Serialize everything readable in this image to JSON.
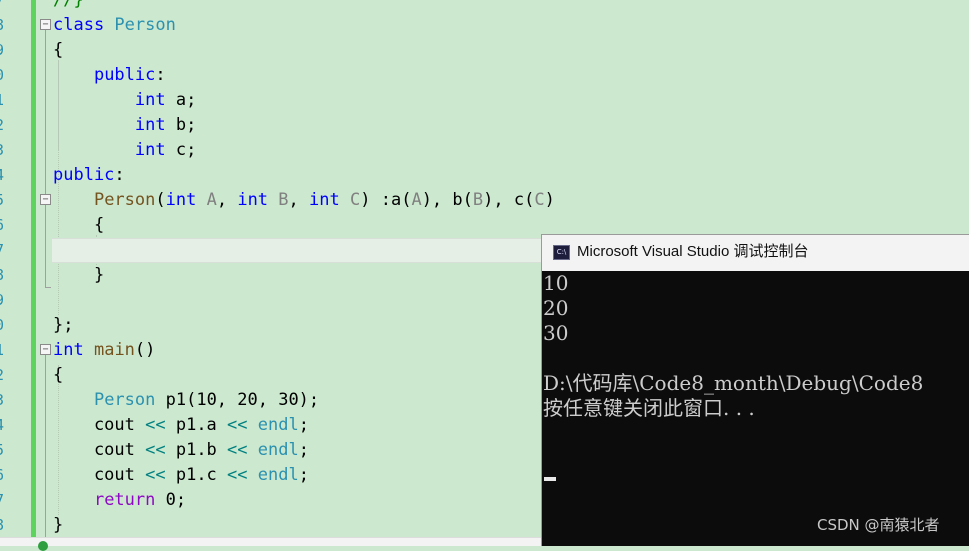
{
  "editor": {
    "line_numbers": [
      "7",
      "8",
      "9",
      "0",
      "1",
      "2",
      "3",
      "4",
      "5",
      "6",
      "7",
      "8",
      "9",
      "0",
      "1",
      "2",
      "3",
      "4",
      "5",
      "6",
      "7",
      "8"
    ],
    "lines": [
      [
        {
          "c": "cm",
          "t": "//}"
        }
      ],
      [
        {
          "c": "kw",
          "t": "class "
        },
        {
          "c": "cls",
          "t": "Person"
        }
      ],
      [
        {
          "c": "",
          "t": "{"
        }
      ],
      [
        {
          "c": "",
          "t": "    "
        },
        {
          "c": "kw",
          "t": "public"
        },
        {
          "c": "",
          "t": ":"
        }
      ],
      [
        {
          "c": "",
          "t": "        "
        },
        {
          "c": "kw",
          "t": "int"
        },
        {
          "c": "",
          "t": " a;"
        }
      ],
      [
        {
          "c": "",
          "t": "        "
        },
        {
          "c": "kw",
          "t": "int"
        },
        {
          "c": "",
          "t": " b;"
        }
      ],
      [
        {
          "c": "",
          "t": "        "
        },
        {
          "c": "kw",
          "t": "int"
        },
        {
          "c": "",
          "t": " c;"
        }
      ],
      [
        {
          "c": "kw",
          "t": "public"
        },
        {
          "c": "",
          "t": ":"
        }
      ],
      [
        {
          "c": "",
          "t": "    "
        },
        {
          "c": "fn",
          "t": "Person"
        },
        {
          "c": "",
          "t": "("
        },
        {
          "c": "kw",
          "t": "int"
        },
        {
          "c": "",
          "t": " "
        },
        {
          "c": "param",
          "t": "A"
        },
        {
          "c": "",
          "t": ", "
        },
        {
          "c": "kw",
          "t": "int"
        },
        {
          "c": "",
          "t": " "
        },
        {
          "c": "param",
          "t": "B"
        },
        {
          "c": "",
          "t": ", "
        },
        {
          "c": "kw",
          "t": "int"
        },
        {
          "c": "",
          "t": " "
        },
        {
          "c": "param",
          "t": "C"
        },
        {
          "c": "",
          "t": ") :a("
        },
        {
          "c": "param",
          "t": "A"
        },
        {
          "c": "",
          "t": "), b("
        },
        {
          "c": "param",
          "t": "B"
        },
        {
          "c": "",
          "t": "), c("
        },
        {
          "c": "param",
          "t": "C"
        },
        {
          "c": "",
          "t": ")"
        }
      ],
      [
        {
          "c": "",
          "t": "    {"
        }
      ],
      [
        {
          "c": "",
          "t": ""
        }
      ],
      [
        {
          "c": "",
          "t": "    }"
        }
      ],
      [
        {
          "c": "",
          "t": ""
        }
      ],
      [
        {
          "c": "",
          "t": "};"
        }
      ],
      [
        {
          "c": "kw",
          "t": "int"
        },
        {
          "c": "",
          "t": " "
        },
        {
          "c": "fn",
          "t": "main"
        },
        {
          "c": "",
          "t": "()"
        }
      ],
      [
        {
          "c": "",
          "t": "{"
        }
      ],
      [
        {
          "c": "",
          "t": "    "
        },
        {
          "c": "cls",
          "t": "Person"
        },
        {
          "c": "",
          "t": " "
        },
        {
          "c": "",
          "t": "p1(10, 20, 30);"
        }
      ],
      [
        {
          "c": "",
          "t": "    cout "
        },
        {
          "c": "op",
          "t": "<<"
        },
        {
          "c": "",
          "t": " p1.a "
        },
        {
          "c": "op",
          "t": "<<"
        },
        {
          "c": "",
          "t": " "
        },
        {
          "c": "endl",
          "t": "endl"
        },
        {
          "c": "",
          "t": ";"
        }
      ],
      [
        {
          "c": "",
          "t": "    cout "
        },
        {
          "c": "op",
          "t": "<<"
        },
        {
          "c": "",
          "t": " p1.b "
        },
        {
          "c": "op",
          "t": "<<"
        },
        {
          "c": "",
          "t": " "
        },
        {
          "c": "endl",
          "t": "endl"
        },
        {
          "c": "",
          "t": ";"
        }
      ],
      [
        {
          "c": "",
          "t": "    cout "
        },
        {
          "c": "op",
          "t": "<<"
        },
        {
          "c": "",
          "t": " p1.c "
        },
        {
          "c": "op",
          "t": "<<"
        },
        {
          "c": "",
          "t": " "
        },
        {
          "c": "endl",
          "t": "endl"
        },
        {
          "c": "",
          "t": ";"
        }
      ],
      [
        {
          "c": "",
          "t": "    "
        },
        {
          "c": "ret",
          "t": "return"
        },
        {
          "c": "",
          "t": " 0;"
        }
      ],
      [
        {
          "c": "",
          "t": "}"
        }
      ]
    ],
    "fold_icon": "minus-box-icon"
  },
  "console": {
    "title": "Microsoft Visual Studio 调试控制台",
    "icon": "console-app-icon",
    "icon_text": "C:\\",
    "output": [
      "10",
      "20",
      "30",
      "",
      "D:\\代码库\\Code8_month\\Debug\\Code8",
      "按任意键关闭此窗口. . ."
    ]
  },
  "watermark": "CSDN @南猿北者",
  "colors": {
    "editor_bg": "#cce8cf",
    "keyword": "#0000ff",
    "type": "#2b91af",
    "function": "#74531f",
    "console_bg": "#0c0c0c"
  }
}
